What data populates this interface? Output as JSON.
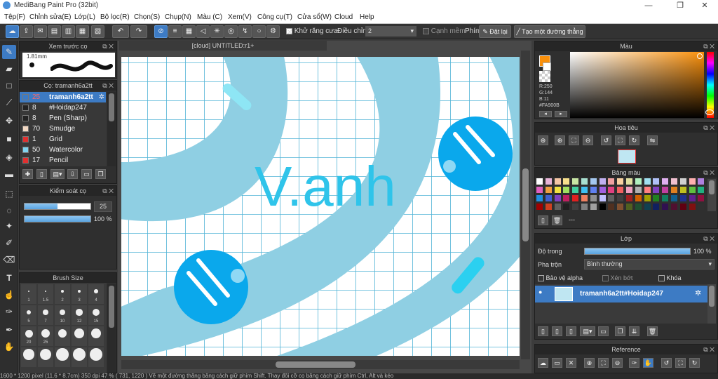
{
  "window": {
    "title": "MediBang Paint Pro (32bit)",
    "min": "—",
    "max": "❐",
    "close": "✕"
  },
  "menu": [
    "Tệp(F)",
    "Chỉnh sửa(E)",
    "Lớp(L)",
    "Bộ lọc(R)",
    "Chọn(S)",
    "Chụp(N)",
    "Màu (C)",
    "Xem(V)",
    "Công cụ(T)",
    "Cửa sổ(W)",
    "Cloud",
    "Help"
  ],
  "toolbar": {
    "antialias": "Khử răng cưa",
    "adjust_label": "Điều chỉnh",
    "adjust_value": "2",
    "snap": "Cạnh mềm",
    "key_label": "Phím",
    "reset": "Đặt lại",
    "create_line": "Tạo một đường thẳng"
  },
  "brush_preview": {
    "title": "Xem trước cọ",
    "size": "1.81mm"
  },
  "brush_panel": {
    "title": "Cọ: tramanh6a2tt",
    "items": [
      {
        "n": "25",
        "name": "tramanh6a2tt",
        "color": "#3d7bc4"
      },
      {
        "n": "8",
        "name": "#Hoidap247",
        "color": "#222222"
      },
      {
        "n": "8",
        "name": "Pen (Sharp)",
        "color": "#222222"
      },
      {
        "n": "70",
        "name": "Smudge",
        "color": "#f2d9c4"
      },
      {
        "n": "1",
        "name": "Grid",
        "color": "#e03030"
      },
      {
        "n": "50",
        "name": "Watercolor",
        "color": "#7fd4f0"
      },
      {
        "n": "17",
        "name": "Pencil",
        "color": "#e03030"
      }
    ]
  },
  "brush_control": {
    "title": "Kiểm soát cọ",
    "size": "25",
    "opacity": "100 %",
    "size_fill": 0.5,
    "opacity_fill": 1.0
  },
  "brush_size": {
    "title": "Brush Size",
    "labels": [
      "1",
      "1.5",
      "2",
      "3",
      "4",
      "5",
      "7",
      "10",
      "12",
      "15",
      "20",
      "25"
    ]
  },
  "document": {
    "tab": "[cloud] UNTITLED:r1+",
    "text": "V.anh"
  },
  "color_panel": {
    "title": "Màu",
    "r": "R:250",
    "g": "G:144",
    "b": "B:11",
    "hex": "#FA900B",
    "primary": "#fa900b"
  },
  "navigator": {
    "title": "Hoa tiêu"
  },
  "palette": {
    "title": "Bảng màu",
    "more": "---"
  },
  "layer_panel": {
    "title": "Lớp",
    "opacity_label": "Độ trong",
    "opacity": "100 %",
    "opacity_fill": 1.0,
    "blend_label": "Pha trộn",
    "blend": "Bình thường",
    "protect": "Bảo vệ alpha",
    "clip": "Xén bớt",
    "lock": "Khóa",
    "layer_name": "tramanh6a2tt#Hoidap247"
  },
  "reference": {
    "title": "Reference"
  },
  "status": "1600 * 1200 pixel   (11.6 * 8.7cm)   350 dpi   47 %   ( 731, 1220 )   Vẽ một đường thẳng bằng cách giữ phím Shift. Thay đổi cỡ cọ bằng cách giữ phím Ctrl, Alt và kéo"
}
